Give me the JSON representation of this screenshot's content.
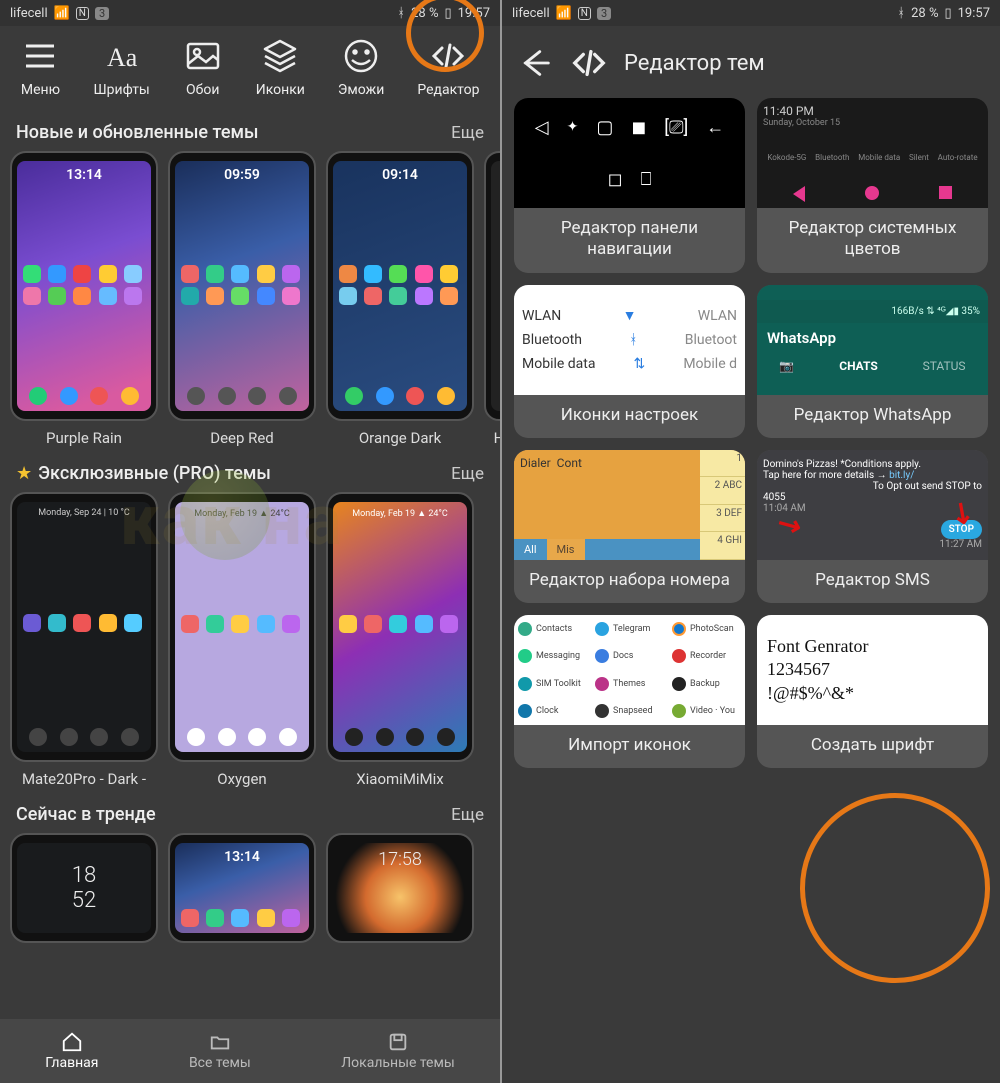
{
  "status": {
    "carrier": "lifecell",
    "badge": "3",
    "battery_pct": "28 %",
    "time": "19:57"
  },
  "toolbar": {
    "menu": "Меню",
    "fonts": "Шрифты",
    "wallpapers": "Обои",
    "icons": "Иконки",
    "emoji": "Эможи",
    "editor": "Редактор"
  },
  "sections": {
    "new": {
      "title": "Новые и обновленные темы",
      "more": "Еще"
    },
    "pro": {
      "title": "Эксклюзивные (PRO) темы",
      "more": "Еще"
    },
    "trend": {
      "title": "Сейчас в тренде",
      "more": "Еще"
    }
  },
  "themes_new": [
    {
      "name": "Purple Rain",
      "clock": "13:14"
    },
    {
      "name": "Deep Red",
      "clock": "09:59"
    },
    {
      "name": "Orange Dark",
      "clock": "09:14"
    },
    {
      "name": "H",
      "clock": ""
    }
  ],
  "themes_pro": [
    {
      "name": "Mate20Pro - Dark -",
      "clock": "Monday, Sep 24  | 10 °C"
    },
    {
      "name": "Oxygen",
      "clock": "Monday, Feb 19  ▲ 24°C"
    },
    {
      "name": "XiaomiMiMix",
      "clock": "Monday, Feb 19  ▲ 24°C"
    }
  ],
  "themes_trend": [
    {
      "clock": "18\n52"
    },
    {
      "clock": "13:14"
    },
    {
      "clock": "17:58"
    }
  ],
  "bottomnav": {
    "home": "Главная",
    "all": "Все темы",
    "local": "Локальные темы"
  },
  "editor": {
    "header": "Редактор тем",
    "cards": {
      "nav": "Редактор панели навигации",
      "sys": "Редактор системных цветов",
      "settings": "Иконки настроек",
      "whatsapp": "Редактор WhatsApp",
      "dialer": "Редактор набора номера",
      "sms": "Редактор SMS",
      "import": "Импорт иконок",
      "font": "Создать шрифт"
    },
    "preview": {
      "sys_time": "11:40 PM",
      "sys_date": "Sunday, October 15",
      "sys_labels": [
        "Kokode-5G",
        "Bluetooth",
        "Mobile data",
        "Silent",
        "Auto-rotate"
      ],
      "settings_rows": [
        "WLAN",
        "Bluetooth",
        "Mobile data"
      ],
      "settings_right": [
        "WLAN",
        "Bluetoot",
        "Mobile d"
      ],
      "wa_status": "166B/s ⇅  ⁴ᴳ◢▮ 35%",
      "wa_title": "WhatsApp",
      "wa_tabs": [
        "CHATS",
        "STATUS"
      ],
      "dialer_tabs": [
        "Dialer",
        "Cont"
      ],
      "dialer_sub": [
        "All",
        "Mis"
      ],
      "dialer_keys": [
        "1",
        "2 ABC",
        "3 DEF",
        "4 GHI"
      ],
      "sms_line1": "Domino's Pizzas! *Conditions apply.",
      "sms_line2": "Tap here for more details →",
      "sms_line3": "To Opt out send STOP to",
      "sms_num": "4055",
      "sms_t1": "11:04 AM",
      "sms_stop": "STOP",
      "sms_t2": "11:27 AM",
      "import_items": [
        "Contacts",
        "Telegram",
        "PhotoScan",
        "Messaging",
        "Docs",
        "Recorder",
        "SIM Toolkit",
        "Themes",
        "Backup",
        "Clock",
        "Snapseed",
        "Video · You"
      ],
      "font_l1": "Font Genrator",
      "font_l2": "1234567",
      "font_l3": "!@#$%^&*"
    }
  }
}
